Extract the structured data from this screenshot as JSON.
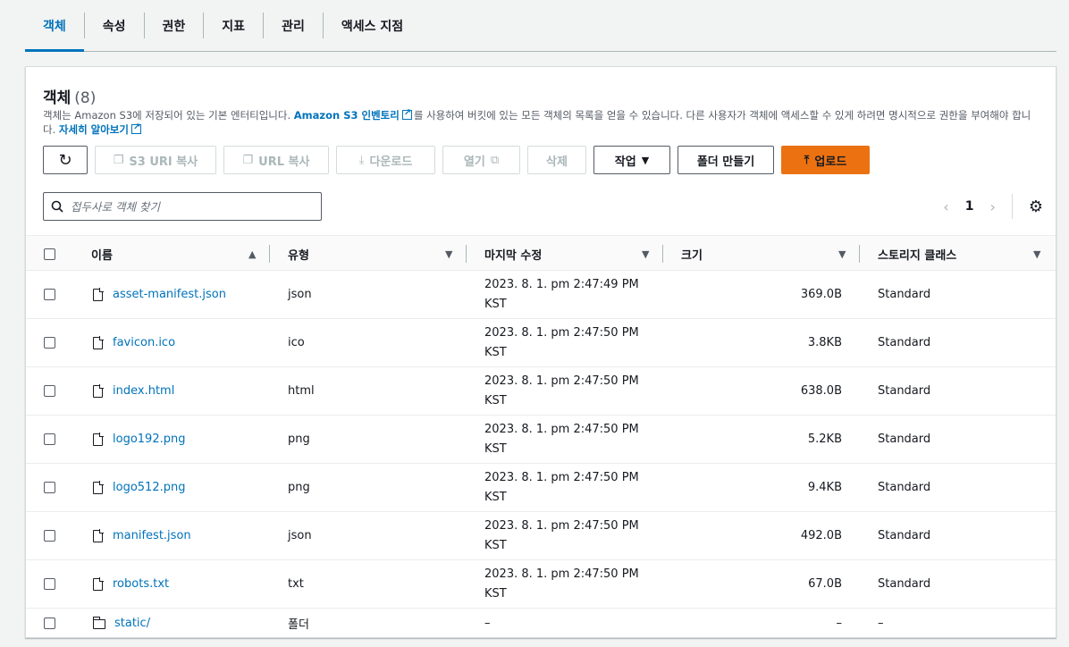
{
  "tabs": [
    {
      "label": "객체"
    },
    {
      "label": "속성"
    },
    {
      "label": "권한"
    },
    {
      "label": "지표"
    },
    {
      "label": "관리"
    },
    {
      "label": "액세스 지점"
    }
  ],
  "panel": {
    "title": "객체",
    "count": "(8)",
    "desc_before": "객체는 Amazon S3에 저장되어 있는 기본 엔터티입니다. ",
    "desc_link": "Amazon S3 인벤토리",
    "desc_after": "를 사용하여 버킷에 있는 모든 객체의 목록을 얻을 수 있습니다. 다른 사용자가 객체에 액세스할 수 있게 하려면 명시적으로 권한을 부여해야 합니다. ",
    "learn_more": "자세히 알아보기"
  },
  "toolbar": {
    "refresh_icon": "↻",
    "copy_s3_uri": "S3 URI 복사",
    "copy_url": "URL 복사",
    "download": "다운로드",
    "open": "열기",
    "delete": "삭제",
    "actions": "작업",
    "create_folder": "폴더 만들기",
    "upload": "업로드"
  },
  "search": {
    "placeholder": "접두사로 객체 찾기"
  },
  "pager": {
    "prev": "‹",
    "page": "1",
    "next": "›",
    "settings_icon": "⚙"
  },
  "table": {
    "columns": {
      "name": "이름",
      "type": "유형",
      "modified": "마지막 수정",
      "size": "크기",
      "storage": "스토리지 클래스"
    },
    "sort_asc": "▲",
    "sort_desc": "▼",
    "rows": [
      {
        "name": "asset-manifest.json",
        "type": "json",
        "modified_1": "2023. 8. 1. pm 2:47:49 PM",
        "modified_2": "KST",
        "size": "369.0B",
        "storage": "Standard"
      },
      {
        "name": "favicon.ico",
        "type": "ico",
        "modified_1": "2023. 8. 1. pm 2:47:50 PM",
        "modified_2": "KST",
        "size": "3.8KB",
        "storage": "Standard"
      },
      {
        "name": "index.html",
        "type": "html",
        "modified_1": "2023. 8. 1. pm 2:47:50 PM",
        "modified_2": "KST",
        "size": "638.0B",
        "storage": "Standard"
      },
      {
        "name": "logo192.png",
        "type": "png",
        "modified_1": "2023. 8. 1. pm 2:47:50 PM",
        "modified_2": "KST",
        "size": "5.2KB",
        "storage": "Standard"
      },
      {
        "name": "logo512.png",
        "type": "png",
        "modified_1": "2023. 8. 1. pm 2:47:50 PM",
        "modified_2": "KST",
        "size": "9.4KB",
        "storage": "Standard"
      },
      {
        "name": "manifest.json",
        "type": "json",
        "modified_1": "2023. 8. 1. pm 2:47:50 PM",
        "modified_2": "KST",
        "size": "492.0B",
        "storage": "Standard"
      },
      {
        "name": "robots.txt",
        "type": "txt",
        "modified_1": "2023. 8. 1. pm 2:47:50 PM",
        "modified_2": "KST",
        "size": "67.0B",
        "storage": "Standard"
      }
    ],
    "folder_row": {
      "name": "static/",
      "type": "폴더",
      "modified": "–",
      "size": "–",
      "storage": "–"
    }
  },
  "colors": {
    "accent": "#0073bb",
    "primary_button": "#ec7211"
  }
}
